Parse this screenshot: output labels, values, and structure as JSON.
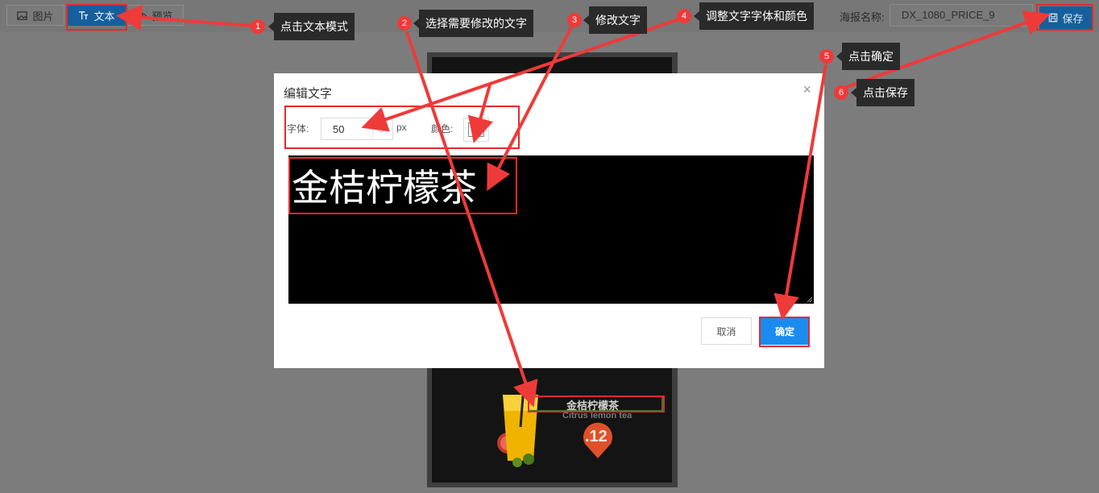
{
  "toolbar": {
    "image_mode_label": "图片",
    "text_mode_label": "文本",
    "preview_label": "预览",
    "poster_name_label": "海报名称:",
    "poster_name_value": "DX_1080_PRICE_9",
    "save_label": "保存",
    "icons": {
      "image": "image-icon",
      "text": "text-icon",
      "preview": "eye-icon",
      "save": "save-icon"
    }
  },
  "poster": {
    "product_title": "金桔柠檬茶",
    "product_subtitle": "Citrus lemon tea",
    "price": ".12"
  },
  "dialog": {
    "title": "编辑文字",
    "font_label": "字体:",
    "font_size": "50",
    "unit": "px",
    "color_label": "颜色:",
    "text_value": "金桔柠檬茶",
    "cancel_label": "取消",
    "confirm_label": "确定"
  },
  "steps": [
    {
      "num": "1",
      "text": "点击文本模式"
    },
    {
      "num": "2",
      "text": "选择需要修改的文字"
    },
    {
      "num": "3",
      "text": "修改文字"
    },
    {
      "num": "4",
      "text": "调整文字字体和颜色"
    },
    {
      "num": "5",
      "text": "点击确定"
    },
    {
      "num": "6",
      "text": "点击保存"
    }
  ],
  "colors": {
    "accent": "#1a8cf0",
    "annotation_red": "#ef3a3a",
    "overlay": "#7c7c7c"
  }
}
